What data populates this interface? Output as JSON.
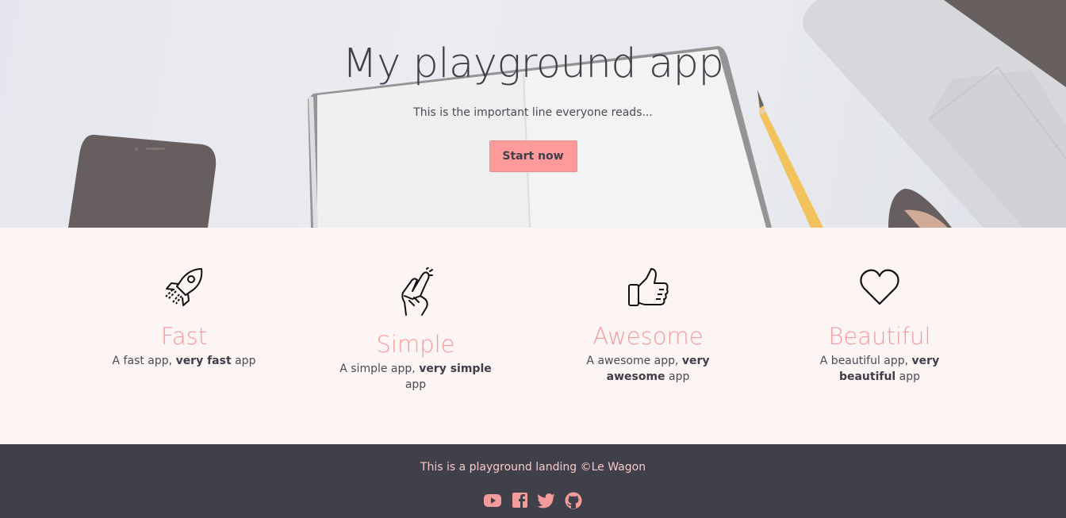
{
  "hero": {
    "title": "My playground app",
    "subtitle": "This is the important line everyone reads...",
    "cta_label": "Start now"
  },
  "features": [
    {
      "icon": "rocket-icon",
      "title": "Fast",
      "desc_prefix": "A fast app, ",
      "desc_bold": "very fast",
      "desc_suffix": " app"
    },
    {
      "icon": "fingers-crossed-icon",
      "title": "Simple",
      "desc_prefix": "A simple app, ",
      "desc_bold": "very simple",
      "desc_suffix": " app"
    },
    {
      "icon": "thumbs-up-icon",
      "title": "Awesome",
      "desc_prefix": "A awesome app, ",
      "desc_bold": "very awesome",
      "desc_suffix": " app"
    },
    {
      "icon": "heart-icon",
      "title": "Beautiful",
      "desc_prefix": "A beautiful app, ",
      "desc_bold": "very beautiful",
      "desc_suffix": " app"
    }
  ],
  "footer": {
    "text": "This is a playground landing ©Le Wagon",
    "social_icons": [
      "youtube-icon",
      "facebook-icon",
      "twitter-icon",
      "github-icon"
    ]
  },
  "colors": {
    "accent": "#ff9a9a",
    "heading_pink": "#f49b9b",
    "dark": "#3f4049",
    "feature_bg": "#fdf4f4",
    "footer_text": "#f9c9c9"
  }
}
